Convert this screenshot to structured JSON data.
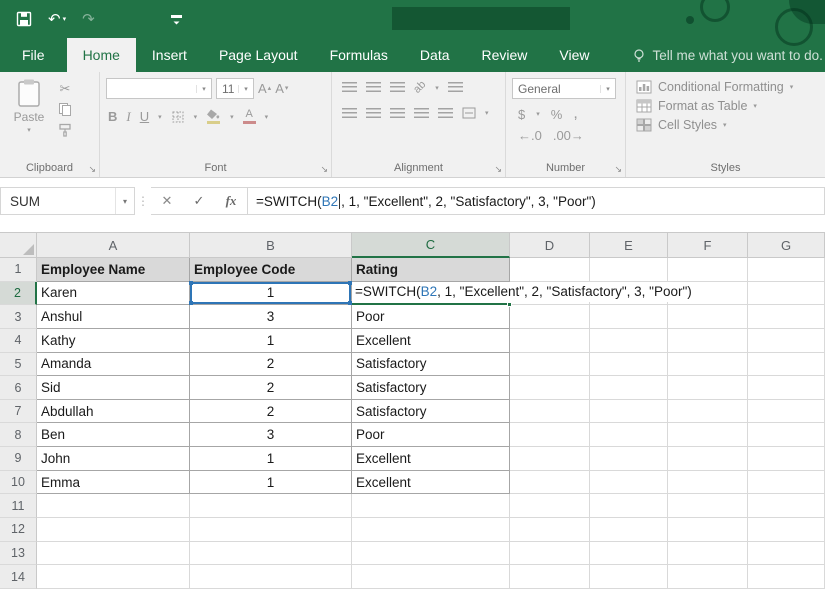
{
  "colors": {
    "accent_green": "#217346",
    "reference_blue": "#2E75B6",
    "header_row_fill": "#D9D9D9"
  },
  "icons": {
    "save": "save-icon",
    "undo": "↶",
    "redo": "↷",
    "dropdown": "▾",
    "cut": "✂",
    "bold": "B",
    "italic": "I",
    "underline": "U",
    "font_increase": "A",
    "font_decrease": "A",
    "currency": "$",
    "percent": "%",
    "comma": ",",
    "decimal_increase": "←.0",
    "decimal_decrease": ".00→",
    "launcher": "↘",
    "dots": "⋮",
    "cancel": "✕",
    "enter": "✓",
    "fx": "fx",
    "font_color_letter": "A",
    "orientation": "ab"
  },
  "tabs": {
    "items": [
      "File",
      "Home",
      "Insert",
      "Page Layout",
      "Formulas",
      "Data",
      "Review",
      "View"
    ],
    "active": "Home",
    "tell_me": "Tell me what you want to do."
  },
  "ribbon": {
    "clipboard": {
      "label": "Clipboard",
      "paste": "Paste"
    },
    "font": {
      "label": "Font",
      "font_name": "",
      "font_size": "11"
    },
    "alignment": {
      "label": "Alignment"
    },
    "number": {
      "label": "Number",
      "format": "General"
    },
    "styles": {
      "label": "Styles",
      "conditional_formatting": "Conditional Formatting",
      "format_as_table": "Format as Table",
      "cell_styles": "Cell Styles"
    }
  },
  "formula_bar": {
    "name_box": "SUM",
    "formula": {
      "prefix": "=SWITCH(",
      "ref": "B2",
      "suffix": ", 1, \"Excellent\", 2, \"Satisfactory\", 3, \"Poor\")"
    }
  },
  "sheet": {
    "columns": [
      "A",
      "B",
      "C",
      "D",
      "E",
      "F",
      "G"
    ],
    "selected_column": "C",
    "selected_row": 2,
    "rows": [
      {
        "n": 1,
        "style": "header",
        "cells": {
          "A": "Employee Name",
          "B": "Employee Code",
          "C": "Rating"
        }
      },
      {
        "n": 2,
        "formula_column": "C",
        "cells": {
          "A": "Karen",
          "B": "1"
        }
      },
      {
        "n": 3,
        "cells": {
          "A": "Anshul",
          "B": "3",
          "C": "Poor"
        }
      },
      {
        "n": 4,
        "cells": {
          "A": "Kathy",
          "B": "1",
          "C": "Excellent"
        }
      },
      {
        "n": 5,
        "cells": {
          "A": "Amanda",
          "B": "2",
          "C": "Satisfactory"
        }
      },
      {
        "n": 6,
        "cells": {
          "A": "Sid",
          "B": "2",
          "C": "Satisfactory"
        }
      },
      {
        "n": 7,
        "cells": {
          "A": "Abdullah",
          "B": "2",
          "C": "Satisfactory"
        }
      },
      {
        "n": 8,
        "cells": {
          "A": "Ben",
          "B": "3",
          "C": "Poor"
        }
      },
      {
        "n": 9,
        "cells": {
          "A": "John",
          "B": "1",
          "C": "Excellent"
        }
      },
      {
        "n": 10,
        "cells": {
          "A": "Emma",
          "B": "1",
          "C": "Excellent"
        }
      },
      {
        "n": 11,
        "cells": {}
      },
      {
        "n": 12,
        "cells": {}
      },
      {
        "n": 13,
        "cells": {}
      },
      {
        "n": 14,
        "cells": {}
      }
    ]
  }
}
